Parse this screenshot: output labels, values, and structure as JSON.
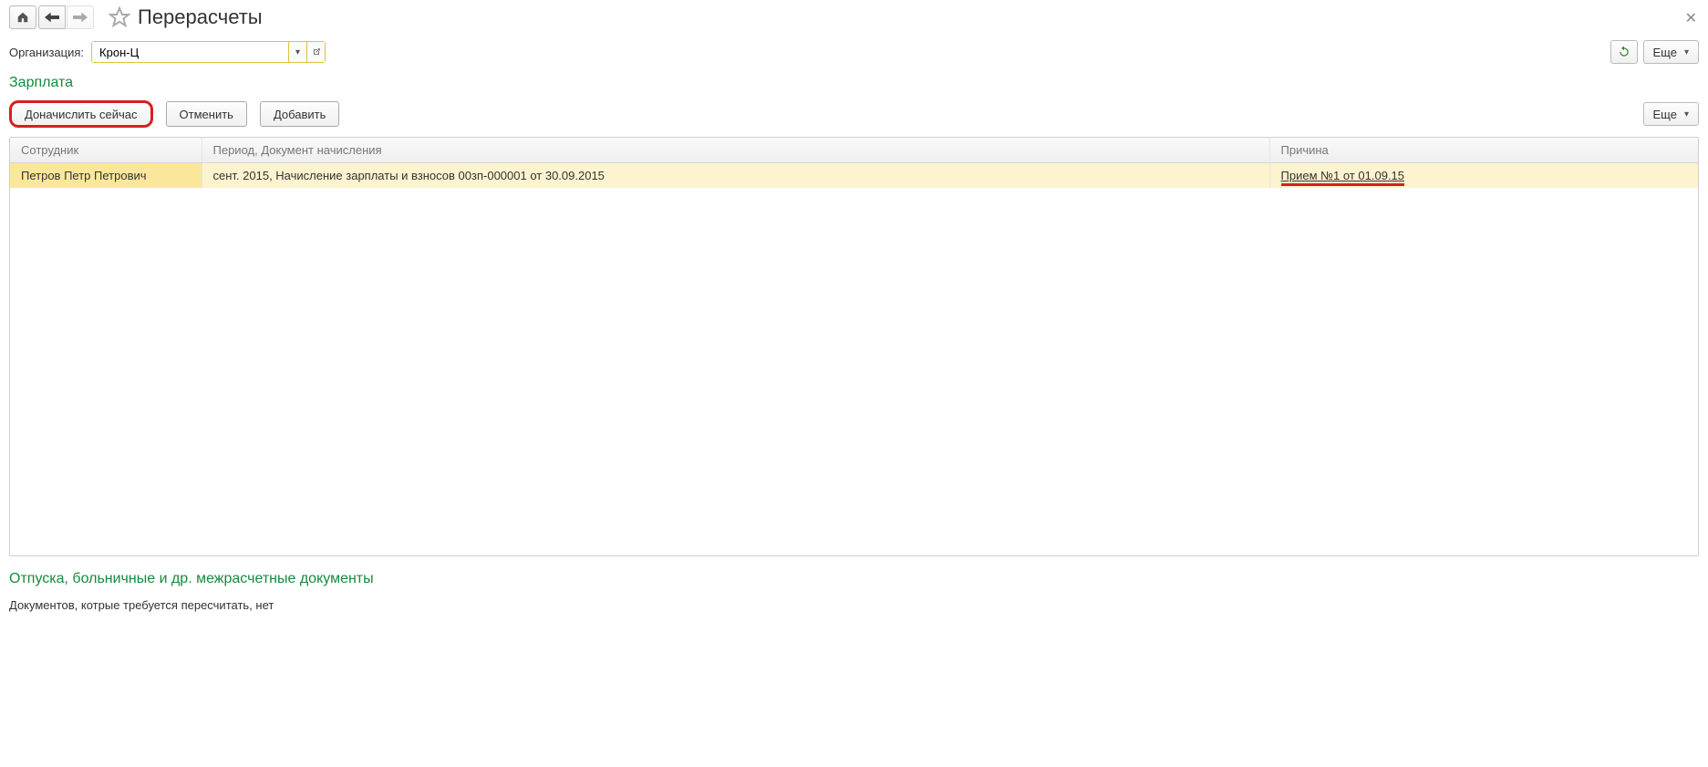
{
  "page": {
    "title": "Перерасчеты"
  },
  "filter": {
    "org_label": "Организация:",
    "org_value": "Крон-Ц"
  },
  "common": {
    "more": "Еще"
  },
  "section": {
    "salary": "Зарплата"
  },
  "toolbar": {
    "accrue_now": "Доначислить сейчас",
    "cancel": "Отменить",
    "add": "Добавить"
  },
  "table": {
    "headers": {
      "employee": "Сотрудник",
      "period": "Период, Документ начисления",
      "reason": "Причина"
    },
    "rows": [
      {
        "employee": "Петров Петр Петрович",
        "period": "сент. 2015, Начисление зарплаты и взносов 00зп-000001 от 30.09.2015",
        "reason": "Прием №1 от 01.09.15"
      }
    ]
  },
  "footer": {
    "title": "Отпуска, больничные и др. межрасчетные документы",
    "message": "Документов, котрые требуется пересчитать, нет"
  }
}
